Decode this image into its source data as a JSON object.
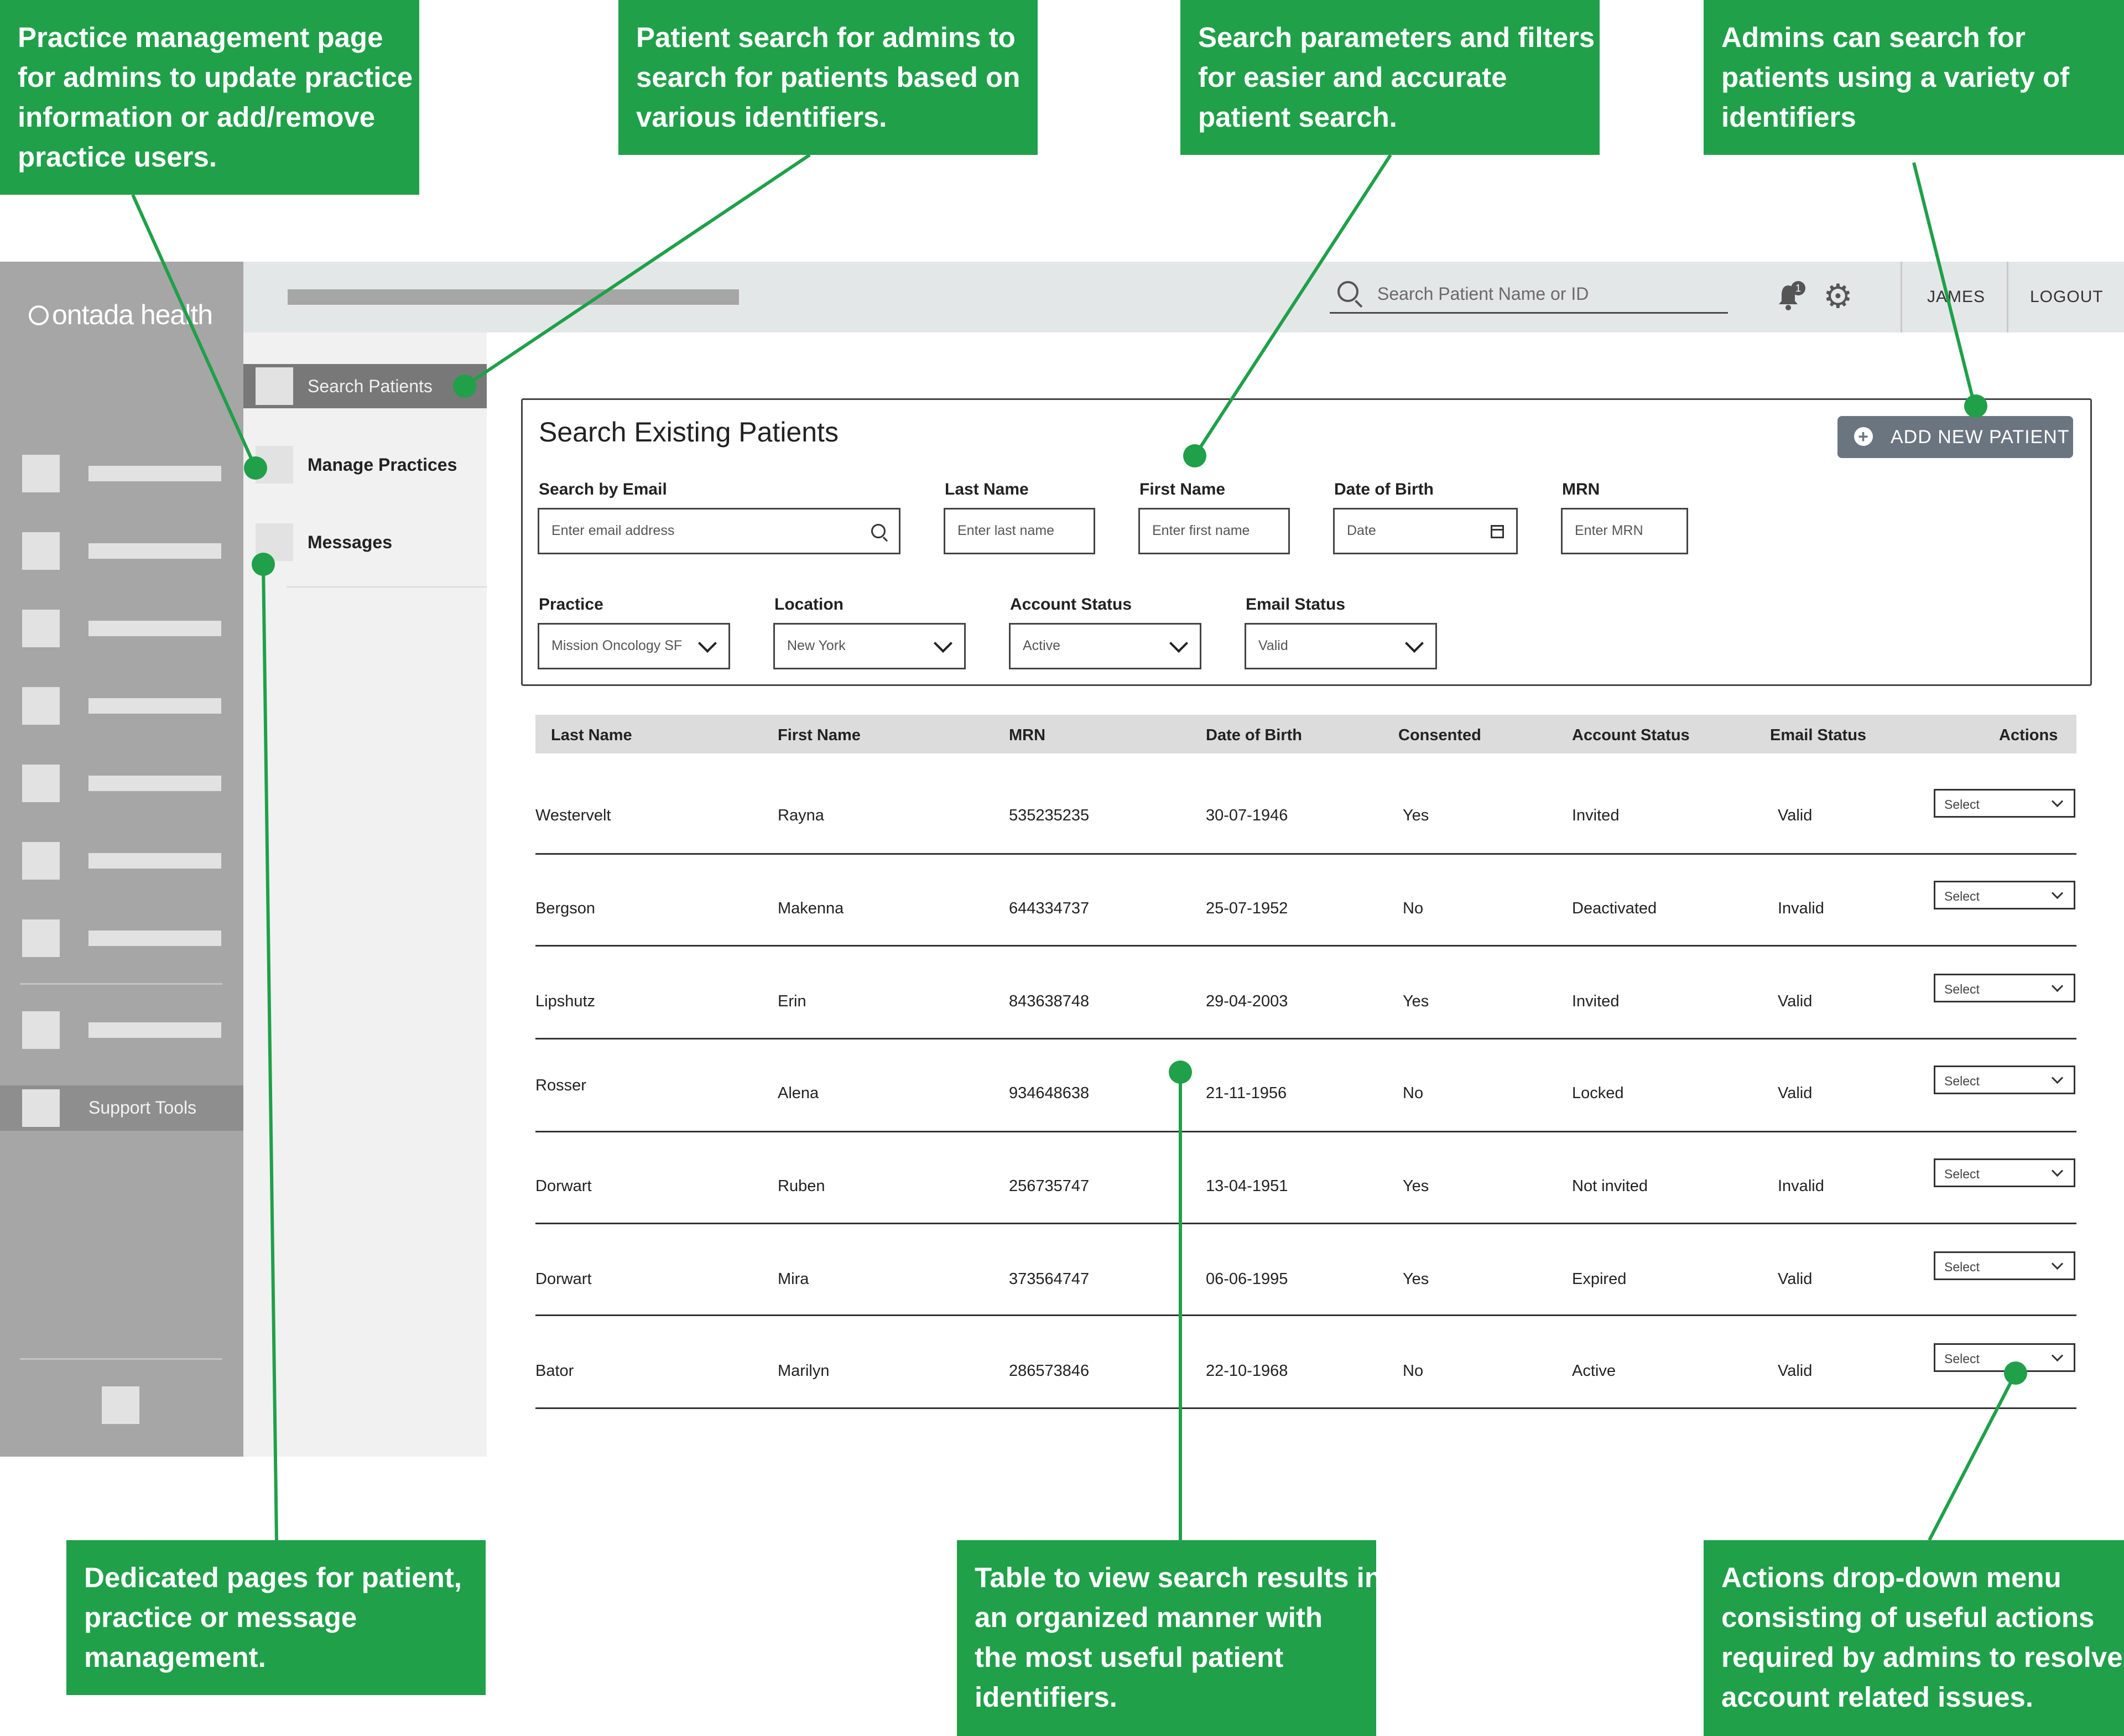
{
  "callouts": {
    "practice_management": [
      "Practice management page",
      "for admins to update practice",
      "information or add/remove",
      "practice users."
    ],
    "patient_search": [
      "Patient search for admins to",
      "search for patients based on",
      "various identifiers."
    ],
    "search_params": [
      "Search parameters and filters",
      "for easier and accurate",
      "patient search."
    ],
    "identifiers": [
      "Admins can search for",
      "patients using a variety of",
      "identifiers"
    ],
    "dedicated_pages": [
      "Dedicated pages for patient,",
      "practice or message",
      "management."
    ],
    "table": [
      "Table to view search results in",
      "an organized manner with",
      "the most useful patient",
      "identifiers."
    ],
    "actions": [
      "Actions drop-down menu",
      "consisting of useful actions",
      "required by admins to resolve",
      "account related issues."
    ]
  },
  "brand": {
    "logo": "ontada health",
    "accent": "#1fa049"
  },
  "header": {
    "search_placeholder": "Search Patient Name or ID",
    "notification_count": "1",
    "user": "JAMES",
    "logout": "LOGOUT"
  },
  "sidebar": {
    "support_tools": "Support Tools"
  },
  "subnav": {
    "search_patients": "Search Patients",
    "manage_practices": "Manage Practices",
    "messages": "Messages"
  },
  "panel": {
    "title": "Search Existing Patients",
    "add_button": "ADD NEW PATIENT",
    "fields": {
      "email": {
        "label": "Search by Email",
        "placeholder": "Enter email address"
      },
      "last_name": {
        "label": "Last Name",
        "placeholder": "Enter last name"
      },
      "first_name": {
        "label": "First Name",
        "placeholder": "Enter first name"
      },
      "dob": {
        "label": "Date of Birth",
        "placeholder": "Date"
      },
      "mrn": {
        "label": "MRN",
        "placeholder": "Enter MRN"
      },
      "practice": {
        "label": "Practice",
        "value": "Mission Oncology SF"
      },
      "location": {
        "label": "Location",
        "value": "New York"
      },
      "account_status": {
        "label": "Account Status",
        "value": "Active"
      },
      "email_status": {
        "label": "Email Status",
        "value": "Valid"
      }
    }
  },
  "table": {
    "headers": [
      "Last Name",
      "First Name",
      "MRN",
      "Date of Birth",
      "Consented",
      "Account Status",
      "Email Status",
      "Actions"
    ],
    "select_label": "Select",
    "rows": [
      [
        "Westervelt",
        "Rayna",
        "535235235",
        "30-07-1946",
        "Yes",
        "Invited",
        "Valid"
      ],
      [
        "Bergson",
        "Makenna",
        "644334737",
        "25-07-1952",
        "No",
        "Deactivated",
        "Invalid"
      ],
      [
        "Lipshutz",
        "Erin",
        "843638748",
        "29-04-2003",
        "Yes",
        "Invited",
        "Valid"
      ],
      [
        "Rosser",
        "Alena",
        "934648638",
        "21-11-1956",
        "No",
        "Locked",
        "Valid"
      ],
      [
        "Dorwart",
        "Ruben",
        "256735747",
        "13-04-1951",
        "Yes",
        "Not invited",
        "Invalid"
      ],
      [
        "Dorwart",
        "Mira",
        "373564747",
        "06-06-1995",
        "Yes",
        "Expired",
        "Valid"
      ],
      [
        "Bator",
        "Marilyn",
        "286573846",
        "22-10-1968",
        "No",
        "Active",
        "Valid"
      ]
    ]
  }
}
